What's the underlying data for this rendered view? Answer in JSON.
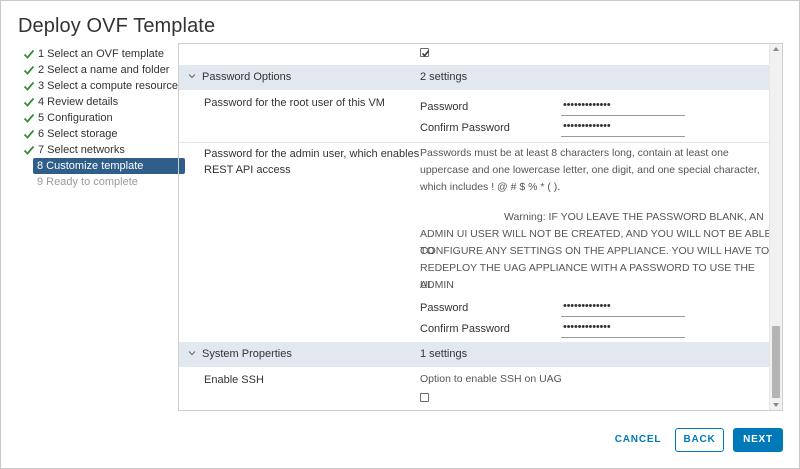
{
  "dialog": {
    "title": "Deploy OVF Template"
  },
  "steps": [
    {
      "label": "1 Select an OVF template",
      "state": "done"
    },
    {
      "label": "2 Select a name and folder",
      "state": "done"
    },
    {
      "label": "3 Select a compute resource",
      "state": "done"
    },
    {
      "label": "4 Review details",
      "state": "done"
    },
    {
      "label": "5 Configuration",
      "state": "done"
    },
    {
      "label": "6 Select storage",
      "state": "done"
    },
    {
      "label": "7 Select networks",
      "state": "done"
    },
    {
      "label": "8 Customize template",
      "state": "active"
    },
    {
      "label": "9 Ready to complete",
      "state": "disabled"
    }
  ],
  "password_options": {
    "name": "Password Options",
    "count": "2 settings",
    "root": {
      "label": "Password for the root user of this VM",
      "password_label": "Password",
      "password_value": "•••••••••••••",
      "confirm_label": "Confirm Password",
      "confirm_value": "•••••••••••••"
    },
    "admin": {
      "label_line1": "Password for the admin user, which enables",
      "label_line2": "REST API access",
      "desc": [
        "Passwords must be at least 8 characters long, contain at least one",
        "uppercase and one lowercase letter, one digit, and one special character,",
        "which includes ! @ # $ % * ( )."
      ],
      "warning": [
        "Warning: IF YOU LEAVE THE PASSWORD BLANK, AN",
        "ADMIN UI USER WILL NOT BE CREATED, AND YOU WILL NOT BE ABLE TO",
        "CONFIGURE ANY SETTINGS ON THE APPLIANCE. YOU WILL HAVE TO",
        "REDEPLOY THE UAG APPLIANCE WITH A PASSWORD TO USE THE ADMIN",
        "UI."
      ],
      "password_label": "Password",
      "password_value": "•••••••••••••",
      "confirm_label": "Confirm Password",
      "confirm_value": "•••••••••••••"
    }
  },
  "system_properties": {
    "name": "System Properties",
    "count": "1 settings",
    "ssh": {
      "label": "Enable SSH",
      "desc": "Option to enable SSH on UAG",
      "checked": false
    }
  },
  "top_checkbox_checked": true,
  "buttons": {
    "cancel": "CANCEL",
    "back": "BACK",
    "next": "NEXT"
  },
  "colors": {
    "accent": "#0079b8",
    "active_step": "#2f5e8a",
    "check": "#3a8f3a",
    "section_bg": "#e1e8ef"
  }
}
